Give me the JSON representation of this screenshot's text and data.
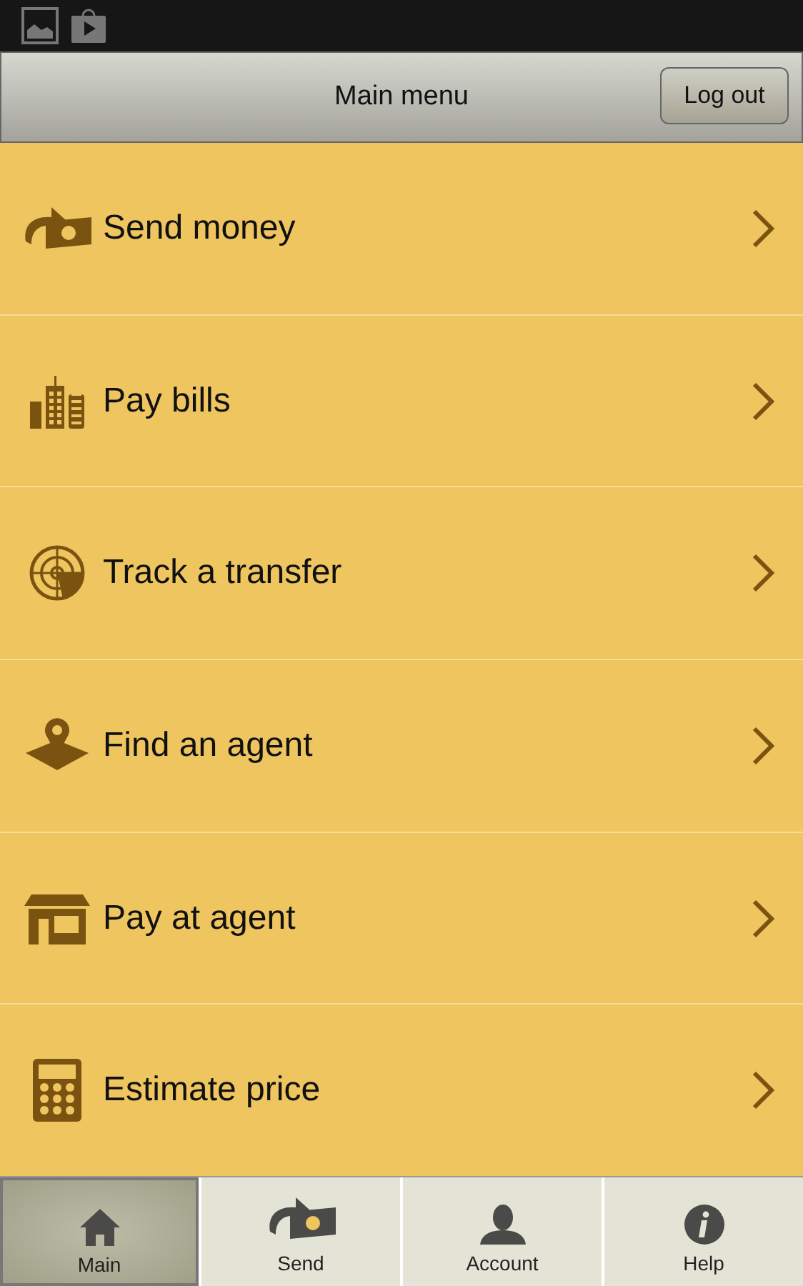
{
  "status_bar": {
    "icons": [
      {
        "kind": "gallery"
      },
      {
        "kind": "store"
      }
    ]
  },
  "header": {
    "title": "Main menu",
    "logout_button": "Log out"
  },
  "menu": [
    {
      "label": "Send money",
      "kind": "money"
    },
    {
      "label": "Pay bills",
      "kind": "buildings"
    },
    {
      "label": "Track a transfer",
      "kind": "radar"
    },
    {
      "label": "Find an agent",
      "kind": "pin"
    },
    {
      "label": "Pay at agent",
      "kind": "shop"
    },
    {
      "label": "Estimate price",
      "kind": "calculator"
    }
  ],
  "tabs": [
    {
      "label": "Main",
      "kind": "home",
      "selected": true
    },
    {
      "label": "Send",
      "kind": "money",
      "selected": false
    },
    {
      "label": "Account",
      "kind": "person",
      "selected": false
    },
    {
      "label": "Help",
      "kind": "info",
      "selected": false
    }
  ]
}
